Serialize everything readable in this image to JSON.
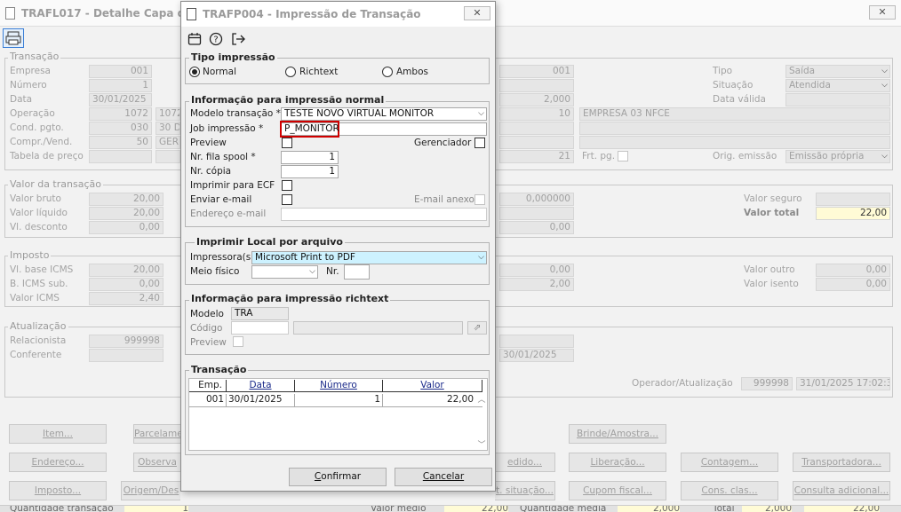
{
  "bg": {
    "title": "TRAFL017 - Detalhe Capa da Tra",
    "groups": {
      "transacao": "Transação",
      "valor": "Valor da transação",
      "imposto": "Imposto",
      "atualizacao": "Atualização"
    },
    "labels": {
      "empresa": "Empresa",
      "numero": "Número",
      "data": "Data",
      "operacao": "Operação",
      "cond": "Cond. pgto.",
      "compr": "Compr./Vend.",
      "tabela": "Tabela de preço",
      "tipo": "Tipo",
      "situacao": "Situação",
      "data_valida": "Data válida",
      "frt": "Frt. pg.",
      "orig": "Orig. emissão",
      "vbruto": "Valor bruto",
      "vliquido": "Valor líquido",
      "vdesconto": "Vl. desconto",
      "vseguro": "Valor seguro",
      "vtotal": "Valor total",
      "vbase": "Vl. base ICMS",
      "bsub": "B. ICMS sub.",
      "vicms": "Valor ICMS",
      "voutro": "Valor outro",
      "visento": "Valor isento",
      "relacionista": "Relacionista",
      "conferente": "Conferente",
      "operador": "Operador/Atualização"
    },
    "values": {
      "empresa": "001",
      "numero": "1",
      "data": "30/01/2025",
      "operacao": "1072",
      "operacao2": "1072",
      "cond": "030",
      "cond2": "30 D",
      "compr": "50",
      "compr2": "GER",
      "r_empresa": "001",
      "r_2000": "2,000",
      "r_10": "10",
      "r_empresa_nome": "EMPRESA 03 NFCE",
      "r_21": "21",
      "tipo": "Saída",
      "situacao": "Atendida",
      "orig": "Emissão própria",
      "vbruto": "20,00",
      "vliquido": "20,00",
      "vdesconto": "0,00",
      "r_taxa": "0,000000",
      "r_000": "0,00",
      "vtotal": "22,00",
      "vbase": "20,00",
      "bsub": "0,00",
      "vicms": "2,40",
      "r_000b": "0,00",
      "r_200": "2,00",
      "voutro": "0,00",
      "visento": "0,00",
      "relacionista": "999998",
      "data_at": "30/01/2025",
      "operador": "999998",
      "dt_operador": "31/01/2025 17:02:35"
    },
    "buttons": {
      "item": "Item...",
      "parcela": "Parcelame",
      "brinde": "Brinde/Amostra...",
      "endereco": "Endereço...",
      "observ": "Observa",
      "pedido": "edido...",
      "liberacao": "Liberação...",
      "contagem": "Contagem...",
      "transportadora": "Transportadora...",
      "imposto": "Imposto...",
      "origem": "Origem/Des",
      "situacao": "t. situação...",
      "cupom": "Cupom fiscal...",
      "consclas": "Cons. clas...",
      "consulta": "Consulta adicional..."
    }
  },
  "dialog": {
    "title": "TRAFP004 - Impressão de Transação",
    "tipo": {
      "label": "Tipo impressão",
      "normal": "Normal",
      "richtext": "Richtext",
      "ambos": "Ambos"
    },
    "normal": {
      "label": "Informação para impressão normal",
      "modelo_label": "Modelo transação *",
      "modelo_value": "TESTE NOVO VIRTUAL MONITOR",
      "job_label": "Job impressão *",
      "job_value": "P_MONITOR",
      "preview_label": "Preview",
      "gerenciador_label": "Gerenciador",
      "fila_label": "Nr. fila spool *",
      "fila_value": "1",
      "copia_label": "Nr. cópia",
      "copia_value": "1",
      "ecf_label": "Imprimir para ECF",
      "email_label": "Enviar e-mail",
      "email_anexo_label": "E-mail anexo",
      "endereco_label": "Endereço e-mail"
    },
    "local": {
      "label": "Imprimir Local por arquivo",
      "impressora_label": "Impressora(s)",
      "impressora_value": "Microsoft Print to PDF",
      "meio_label": "Meio físico",
      "nr_label": "Nr."
    },
    "rich": {
      "label": "Informação para impressão richtext",
      "modelo_label": "Modelo",
      "modelo_value": "TRA",
      "codigo_label": "Código",
      "preview_label": "Preview"
    },
    "transacao": {
      "label": "Transação",
      "columns": [
        "Emp.",
        "Data",
        "Número",
        "Valor"
      ],
      "rows": [
        [
          "001",
          "30/01/2025",
          "1",
          "22,00"
        ]
      ]
    },
    "confirmar": "Confirmar",
    "cancelar": "Cancelar"
  },
  "footer": {
    "qtd": "Quantidade transação",
    "qtd_val": "1",
    "vmedio": "Valor médio",
    "vmedio_val": "22,00",
    "qmedia": "Quantidade média",
    "qmedia_val": "2,000",
    "total": "Total",
    "total_val": "2,000",
    "total_val2": "22,00"
  }
}
